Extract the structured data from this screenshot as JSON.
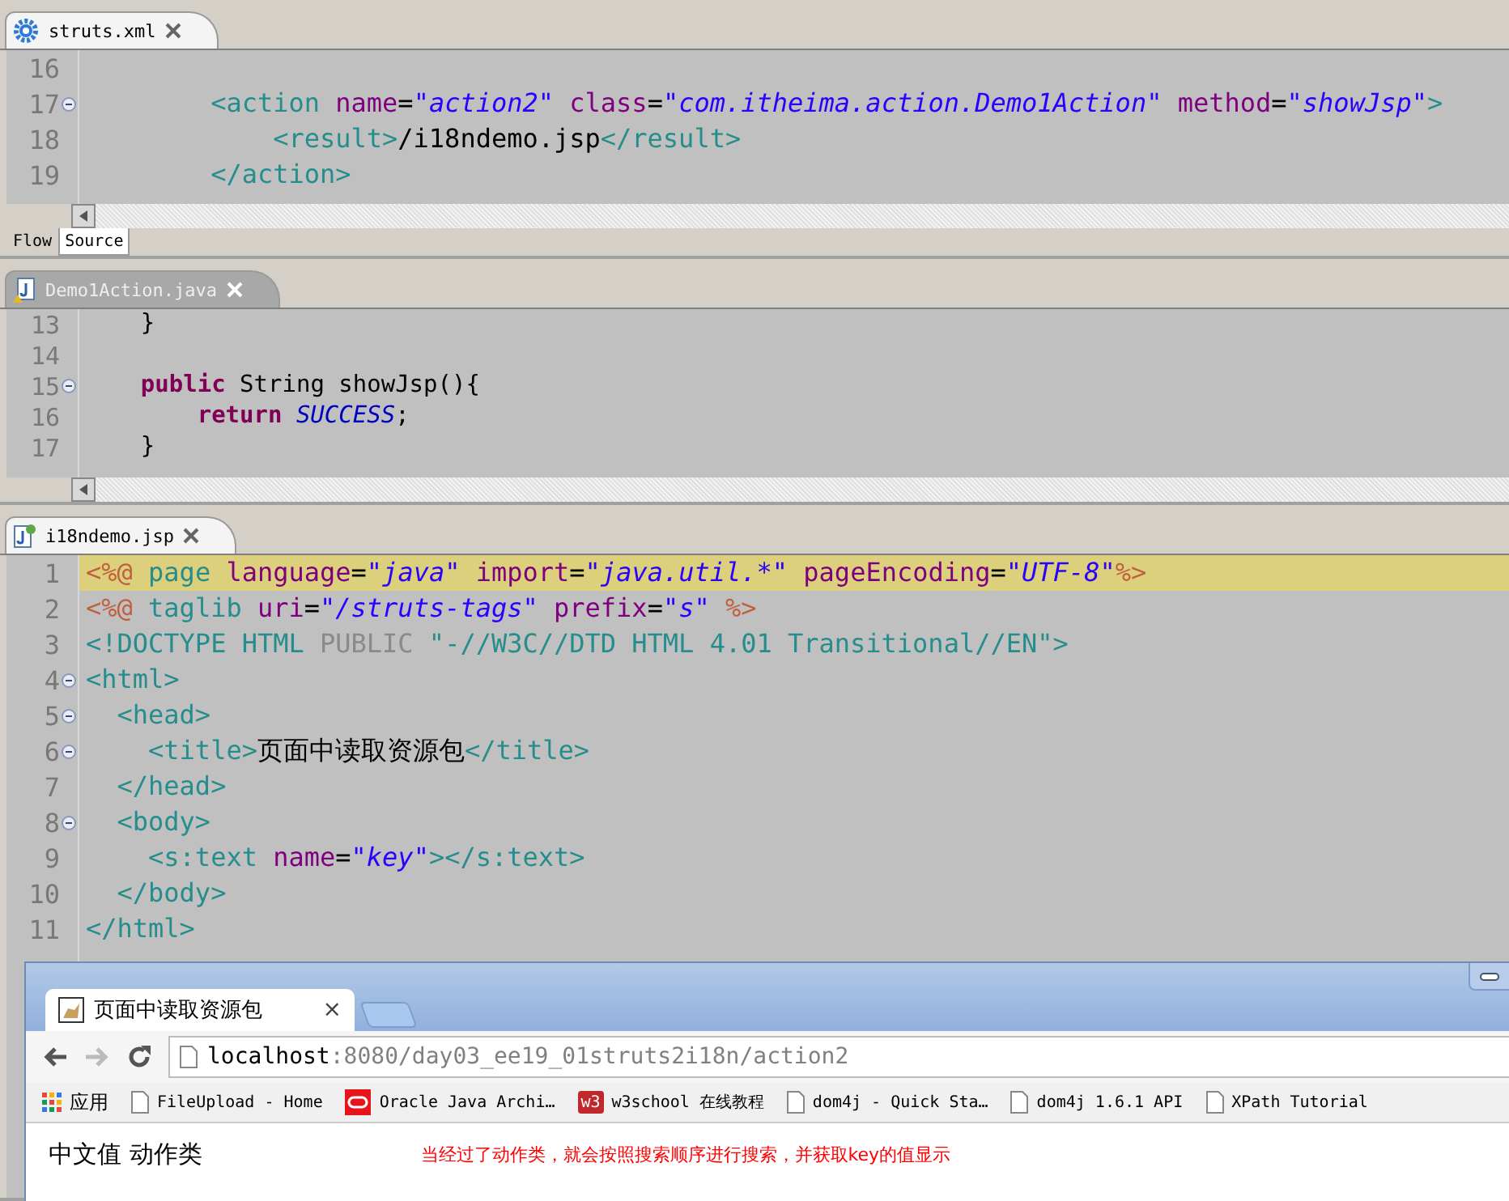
{
  "editors": [
    {
      "tab": {
        "label": "struts.xml",
        "kind": "xml",
        "active": true
      },
      "lines": [
        {
          "number": "16",
          "fold": false,
          "current": false
        },
        {
          "number": "17",
          "fold": true,
          "current": false,
          "tokens": [
            {
              "kind": "tag",
              "text": "        <action"
            },
            {
              "kind": "attr",
              "text": " name"
            },
            {
              "kind": "text",
              "text": "="
            },
            {
              "kind": "str",
              "text": "\"action2\""
            },
            {
              "kind": "attr",
              "text": " class"
            },
            {
              "kind": "text",
              "text": "="
            },
            {
              "kind": "str",
              "text": "\"com.itheima.action.Demo1Action\""
            },
            {
              "kind": "attr",
              "text": " method"
            },
            {
              "kind": "text",
              "text": "="
            },
            {
              "kind": "str",
              "text": "\"showJsp\""
            },
            {
              "kind": "tag",
              "text": ">"
            }
          ]
        },
        {
          "number": "18",
          "fold": false,
          "current": false,
          "tokens": [
            {
              "kind": "tag",
              "text": "            <result>"
            },
            {
              "kind": "text",
              "text": "/i18ndemo.jsp"
            },
            {
              "kind": "tag",
              "text": "</result>"
            }
          ]
        },
        {
          "number": "19",
          "fold": false,
          "current": false,
          "tokens": [
            {
              "kind": "tag",
              "text": "        </action>"
            }
          ]
        }
      ],
      "bottom_tabs": [
        {
          "label": "Flow",
          "selected": false
        },
        {
          "label": "Source",
          "selected": true
        }
      ]
    },
    {
      "tab": {
        "label": "Demo1Action.java",
        "kind": "java",
        "active": false
      },
      "lines": [
        {
          "number": "13",
          "fold": false,
          "current": false,
          "tokens": [
            {
              "kind": "text",
              "text": "    }"
            }
          ]
        },
        {
          "number": "14",
          "fold": false,
          "current": false
        },
        {
          "number": "15",
          "fold": true,
          "current": false,
          "tokens": [
            {
              "kind": "kw",
              "text": "    public"
            },
            {
              "kind": "text",
              "text": " String showJsp(){"
            }
          ]
        },
        {
          "number": "16",
          "fold": false,
          "current": false,
          "tokens": [
            {
              "kind": "kw",
              "text": "        return"
            },
            {
              "kind": "const",
              "text": " SUCCESS"
            },
            {
              "kind": "text",
              "text": ";"
            }
          ]
        },
        {
          "number": "17",
          "fold": false,
          "current": false,
          "tokens": [
            {
              "kind": "text",
              "text": "    }"
            }
          ]
        }
      ]
    },
    {
      "tab": {
        "label": "i18ndemo.jsp",
        "kind": "jsp",
        "active": true
      },
      "lines": [
        {
          "number": "1",
          "fold": false,
          "current": true,
          "tokens": [
            {
              "kind": "dir",
              "text": "<%@"
            },
            {
              "kind": "tag",
              "text": " page"
            },
            {
              "kind": "attr",
              "text": " language"
            },
            {
              "kind": "text",
              "text": "="
            },
            {
              "kind": "str",
              "text": "\"java\""
            },
            {
              "kind": "attr",
              "text": " import"
            },
            {
              "kind": "text",
              "text": "="
            },
            {
              "kind": "str",
              "text": "\"java.util.*\""
            },
            {
              "kind": "attr",
              "text": " pageEncoding"
            },
            {
              "kind": "text",
              "text": "="
            },
            {
              "kind": "str",
              "text": "\"UTF-8\""
            },
            {
              "kind": "dir",
              "text": "%>"
            }
          ]
        },
        {
          "number": "2",
          "fold": false,
          "current": false,
          "tokens": [
            {
              "kind": "dir",
              "text": "<%@"
            },
            {
              "kind": "tag",
              "text": " taglib"
            },
            {
              "kind": "attr",
              "text": " uri"
            },
            {
              "kind": "text",
              "text": "="
            },
            {
              "kind": "str",
              "text": "\"/struts-tags\""
            },
            {
              "kind": "attr",
              "text": " prefix"
            },
            {
              "kind": "text",
              "text": "="
            },
            {
              "kind": "str",
              "text": "\"s\""
            },
            {
              "kind": "dir",
              "text": " %>"
            }
          ]
        },
        {
          "number": "3",
          "fold": false,
          "current": false,
          "tokens": [
            {
              "kind": "tag",
              "text": "<!DOCTYPE HTML"
            },
            {
              "kind": "grey",
              "text": " PUBLIC"
            },
            {
              "kind": "tag",
              "text": " \"-//W3C//DTD HTML 4.01 Transitional//EN\">"
            }
          ]
        },
        {
          "number": "4",
          "fold": true,
          "current": false,
          "tokens": [
            {
              "kind": "tag",
              "text": "<html>"
            }
          ]
        },
        {
          "number": "5",
          "fold": true,
          "current": false,
          "tokens": [
            {
              "kind": "tag",
              "text": "  <head>"
            }
          ]
        },
        {
          "number": "6",
          "fold": true,
          "current": false,
          "tokens": [
            {
              "kind": "tag",
              "text": "    <title>"
            },
            {
              "kind": "text",
              "text": "页面中读取资源包"
            },
            {
              "kind": "tag",
              "text": "</title>"
            }
          ]
        },
        {
          "number": "7",
          "fold": false,
          "current": false,
          "tokens": [
            {
              "kind": "tag",
              "text": "  </head>"
            }
          ]
        },
        {
          "number": "8",
          "fold": true,
          "current": false,
          "tokens": [
            {
              "kind": "tag",
              "text": "  <body>"
            }
          ]
        },
        {
          "number": "9",
          "fold": false,
          "current": false,
          "tokens": [
            {
              "kind": "tag",
              "text": "    <s:text"
            },
            {
              "kind": "attr",
              "text": " name"
            },
            {
              "kind": "text",
              "text": "="
            },
            {
              "kind": "str",
              "text": "\"key\""
            },
            {
              "kind": "tag",
              "text": "></s:text>"
            }
          ]
        },
        {
          "number": "10",
          "fold": false,
          "current": false,
          "tokens": [
            {
              "kind": "tag",
              "text": "  </body>"
            }
          ]
        },
        {
          "number": "11",
          "fold": false,
          "current": false,
          "tokens": [
            {
              "kind": "tag",
              "text": "</html>"
            }
          ]
        }
      ]
    }
  ],
  "browser": {
    "tab": {
      "title": "页面中读取资源包",
      "close": "×"
    },
    "url_host": "localhost",
    "url_path": ":8080/day03_ee19_01struts2i18n/action2",
    "bookmarks": [
      {
        "kind": "apps",
        "label": "应用"
      },
      {
        "kind": "page",
        "label": "FileUpload - Home"
      },
      {
        "kind": "oracle",
        "label": "Oracle Java Archi…"
      },
      {
        "kind": "w3",
        "badge": "w3",
        "label": "w3school 在线教程"
      },
      {
        "kind": "page",
        "label": "dom4j - Quick Sta…"
      },
      {
        "kind": "page",
        "label": "dom4j 1.6.1 API"
      },
      {
        "kind": "page",
        "label": "XPath Tutorial"
      }
    ],
    "content": "中文值 动作类",
    "annotation": "当经过了动作类，就会按照搜索顺序进行搜索，并获取key的值显示"
  }
}
